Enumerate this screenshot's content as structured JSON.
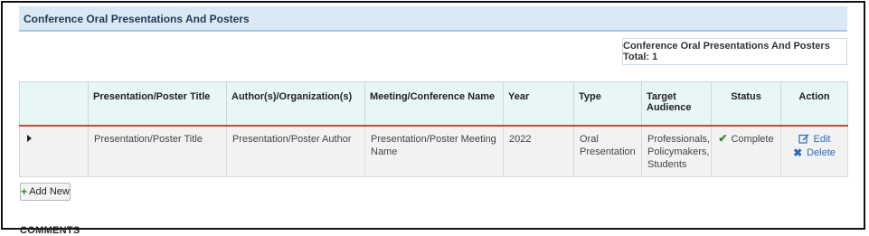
{
  "section": {
    "title": "Conference Oral Presentations And Posters",
    "total_label": "Conference Oral Presentations And Posters Total: 1"
  },
  "table": {
    "columns": [
      "",
      "Presentation/Poster Title",
      "Author(s)/Organization(s)",
      "Meeting/Conference Name",
      "Year",
      "Type",
      "Target Audience",
      "Status",
      "Action"
    ],
    "rows": [
      {
        "title": "Presentation/Poster Title",
        "author": "Presentation/Poster Author",
        "meeting": "Presentation/Poster Meeting Name",
        "year": "2022",
        "type": "Oral Presentation",
        "audience": "Professionals, Policymakers, Students",
        "status": "Complete",
        "edit_label": "Edit",
        "delete_label": "Delete"
      }
    ]
  },
  "add_new_label": "Add New",
  "comments_heading": "COMMENTS",
  "icons": {
    "expand": "caret-right-icon",
    "status": "check-icon",
    "edit": "edit-icon",
    "delete": "x-icon",
    "add": "plus-icon"
  },
  "colors": {
    "header_bg": "#dbe9f5",
    "table_header_bg": "#e8f6f6",
    "header_rule": "#b5523e",
    "link": "#2a6ebb",
    "success": "#2e8b2e"
  }
}
